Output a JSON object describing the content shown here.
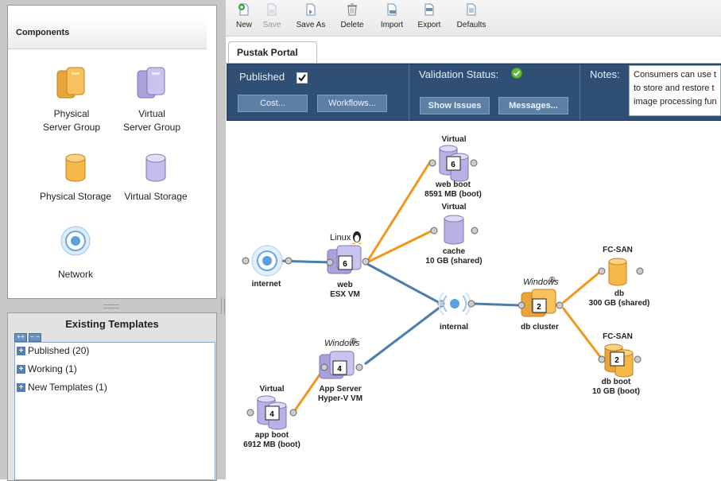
{
  "toolbar": {
    "buttons": [
      {
        "label": "New",
        "icon": "new-icon",
        "enabled": true
      },
      {
        "label": "Save",
        "icon": "save-icon",
        "enabled": false
      },
      {
        "label": "Save As",
        "icon": "save-as-icon",
        "enabled": true
      },
      {
        "label": "Delete",
        "icon": "trash-icon",
        "enabled": true
      },
      {
        "label": "Import",
        "icon": "import-icon",
        "enabled": true
      },
      {
        "label": "Export",
        "icon": "export-icon",
        "enabled": true
      },
      {
        "label": "Defaults",
        "icon": "defaults-icon",
        "enabled": true
      }
    ]
  },
  "components": {
    "title": "Components",
    "items": [
      {
        "label_line1": "Physical",
        "label_line2": "Server Group",
        "icon": "physical-server-group-icon"
      },
      {
        "label_line1": "Virtual",
        "label_line2": "Server Group",
        "icon": "virtual-server-group-icon"
      },
      {
        "label_line1": "Physical Storage",
        "label_line2": "",
        "icon": "physical-storage-icon"
      },
      {
        "label_line1": "Virtual Storage",
        "label_line2": "",
        "icon": "virtual-storage-icon"
      },
      {
        "label_line1": "Network",
        "label_line2": "",
        "icon": "network-icon"
      }
    ]
  },
  "templates": {
    "title": "Existing Templates",
    "expand_all": "++",
    "collapse_all": "− −",
    "items": [
      {
        "label": "Published (20)"
      },
      {
        "label": "Working (1)"
      },
      {
        "label": "New Templates (1)"
      }
    ]
  },
  "tabs": [
    {
      "label": "Pustak Portal"
    }
  ],
  "info": {
    "published_label": "Published",
    "published_checked": true,
    "validation_label": "Validation Status:",
    "notes_label": "Notes:",
    "notes_lines": [
      "Consumers can use t",
      "to store and restore t",
      "image processing fun"
    ],
    "buttons": {
      "cost": "Cost...",
      "workflows": "Workflows...",
      "show_issues": "Show Issues",
      "messages": "Messages..."
    }
  },
  "diagram": {
    "nodes": {
      "internet": {
        "label": "internet"
      },
      "web": {
        "os": "Linux",
        "count": "6",
        "label1": "web",
        "label2": "ESX VM"
      },
      "web_boot": {
        "type": "Virtual",
        "count": "6",
        "label1": "web boot",
        "label2": "8591 MB (boot)"
      },
      "cache": {
        "type": "Virtual",
        "label1": "cache",
        "label2": "10 GB (shared)"
      },
      "internal": {
        "label": "internal"
      },
      "db_cluster": {
        "os": "Windows",
        "count": "2",
        "label1": "db cluster"
      },
      "db": {
        "type": "FC-SAN",
        "label1": "db",
        "label2": "300 GB (shared)"
      },
      "db_boot": {
        "type": "FC-SAN",
        "count": "2",
        "label1": "db boot",
        "label2": "10 GB (boot)"
      },
      "app_server": {
        "os": "Windows",
        "count": "4",
        "label1": "App Server",
        "label2": "Hyper-V VM"
      },
      "app_boot": {
        "type": "Virtual",
        "count": "4",
        "label1": "app boot",
        "label2": "6912 MB (boot)"
      }
    },
    "colors": {
      "network_link": "#4a7fab",
      "storage_link": "#f0981e",
      "physical": "#f5b94a",
      "virtual": "#b7b2e3"
    }
  }
}
